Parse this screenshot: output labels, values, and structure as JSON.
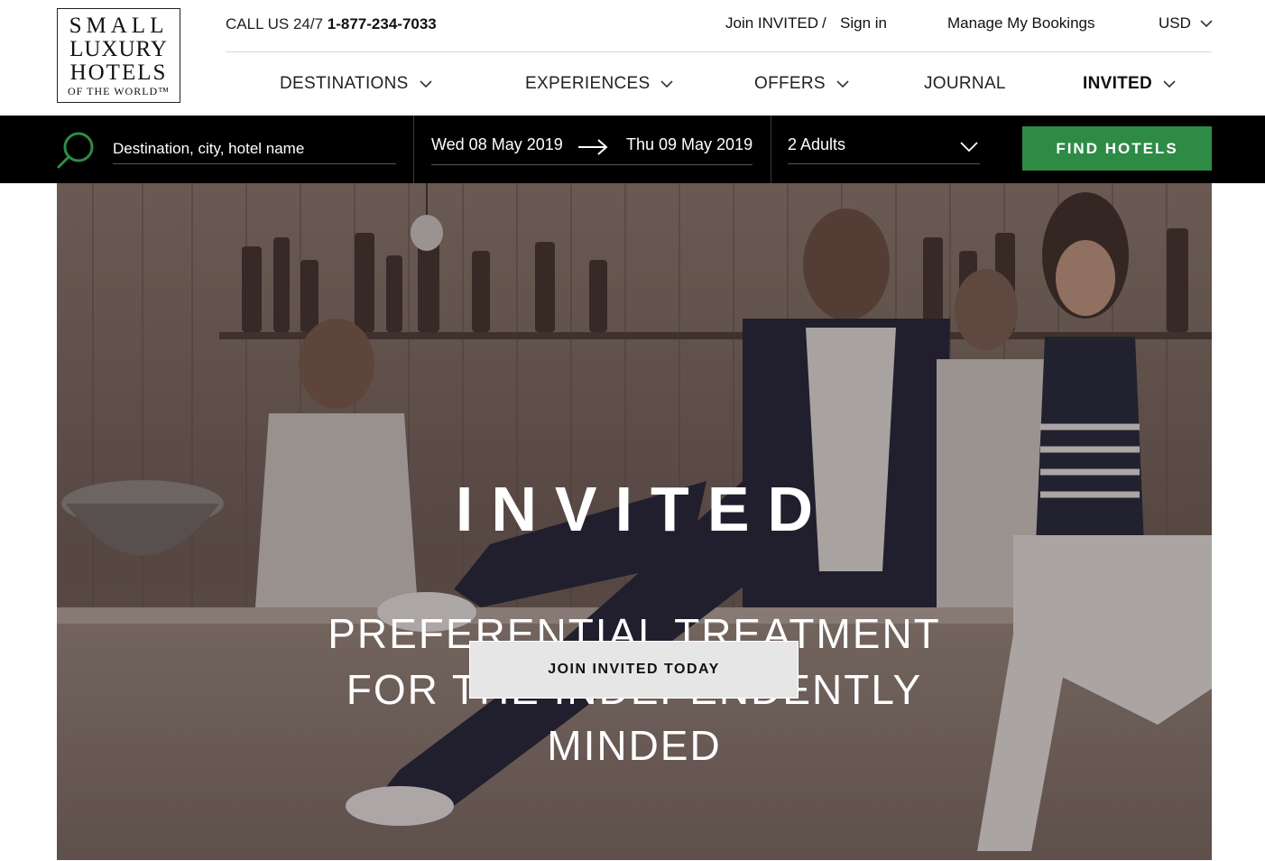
{
  "logo": {
    "line1": "SMALL",
    "line2": "LUXURY",
    "line3": "HOTELS",
    "line4": "OF THE WORLD™"
  },
  "header": {
    "call_prefix": "CALL US 24/7 ",
    "phone": "1-877-234-7033",
    "join_label": "Join INVITED",
    "separator": "/",
    "sign_in_label": "Sign in",
    "manage_label": "Manage My Bookings",
    "currency": "USD",
    "nav": [
      {
        "label": "DESTINATIONS",
        "dropdown": true
      },
      {
        "label": "EXPERIENCES",
        "dropdown": true
      },
      {
        "label": "OFFERS",
        "dropdown": true
      },
      {
        "label": "JOURNAL",
        "dropdown": false
      },
      {
        "label": "INVITED",
        "dropdown": true,
        "active": true
      }
    ]
  },
  "search": {
    "placeholder": "Destination, city, hotel name",
    "date_from": "Wed 08 May 2019",
    "date_to": "Thu 09 May 2019",
    "guests": "2 Adults",
    "button_label": "FIND HOTELS",
    "icon": "search-icon"
  },
  "hero": {
    "title": "INVITED",
    "subtitle_line1": "PREFERENTIAL TREATMENT",
    "subtitle_line2": "FOR THE INDEPENDENTLY",
    "subtitle_line3": "MINDED",
    "cta_label": "JOIN INVITED TODAY"
  },
  "colors": {
    "accent_green": "#2e8b46",
    "search_bar_bg": "#000000",
    "icon_green": "#2e8b46"
  }
}
